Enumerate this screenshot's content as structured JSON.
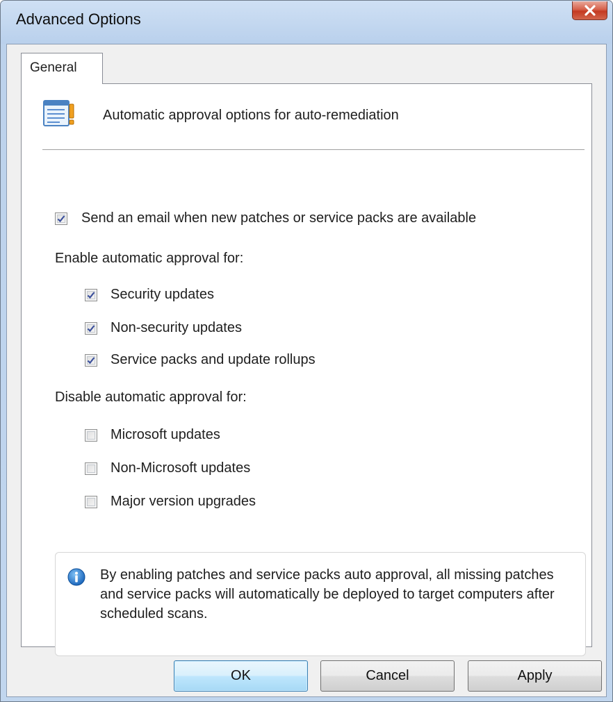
{
  "window": {
    "title": "Advanced Options"
  },
  "tabs": [
    {
      "label": "General"
    }
  ],
  "header": {
    "text": "Automatic approval options for auto-remediation"
  },
  "email_option": {
    "label": "Send an email when new patches or service packs are available",
    "checked": true
  },
  "enable_section": {
    "label": "Enable automatic approval for:",
    "items": [
      {
        "label": "Security updates",
        "checked": true
      },
      {
        "label": "Non-security updates",
        "checked": true
      },
      {
        "label": "Service packs and update rollups",
        "checked": true
      }
    ]
  },
  "disable_section": {
    "label": "Disable automatic approval for:",
    "items": [
      {
        "label": "Microsoft updates",
        "checked": false
      },
      {
        "label": "Non-Microsoft updates",
        "checked": false
      },
      {
        "label": "Major version upgrades",
        "checked": false
      }
    ]
  },
  "info": {
    "text": "By enabling patches and service packs auto approval, all missing patches and service packs will automatically be deployed to target computers after scheduled scans."
  },
  "buttons": {
    "ok": "OK",
    "cancel": "Cancel",
    "apply": "Apply"
  },
  "colors": {
    "accent": "#3c7fb1",
    "check": "#3a4f9b",
    "close": "#c43a22",
    "info_icon": "#1f78d1"
  }
}
